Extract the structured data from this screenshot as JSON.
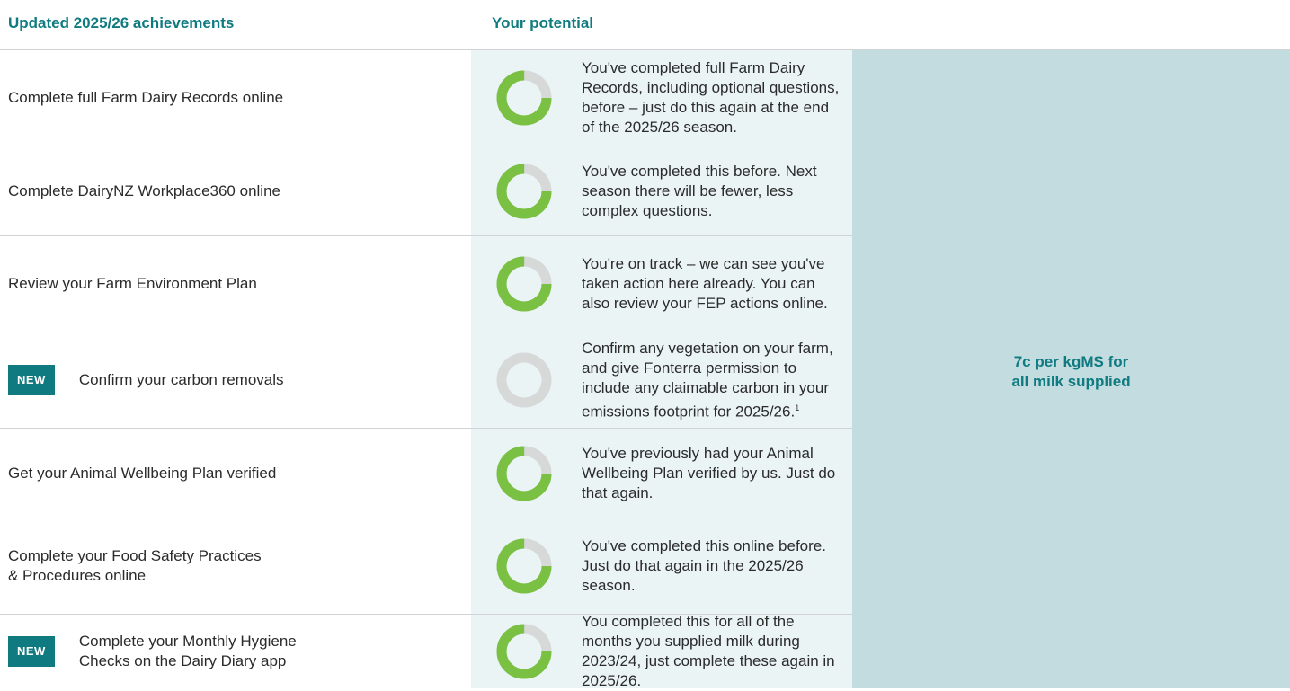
{
  "header": {
    "left": "Updated 2025/26 achievements",
    "right": "Your potential"
  },
  "reward": {
    "line1": "7c per kgMS for",
    "line2": "all milk supplied"
  },
  "colors": {
    "accent": "#0f7b80",
    "ring_done": "#7ac143",
    "ring_todo": "#d7d9d9"
  },
  "rows": [
    {
      "badge": "",
      "achievement": "Complete full Farm Dairy Records online",
      "potential": "You've completed full Farm Dairy Records, including optional questions, before – just do this again at the end of the 2025/26 season.",
      "footnote": "",
      "progress": 0.75
    },
    {
      "badge": "",
      "achievement": "Complete DairyNZ Workplace360 online",
      "potential": "You've completed this before. Next season there will be fewer, less complex questions.",
      "footnote": "",
      "progress": 0.75
    },
    {
      "badge": "",
      "achievement": "Review your Farm Environment Plan",
      "potential": "You're on track – we can see you've taken action here already. You can also review your FEP actions online.",
      "footnote": "",
      "progress": 0.75
    },
    {
      "badge": "NEW",
      "achievement": "Confirm your carbon removals",
      "potential": "Confirm any vegetation on your farm, and give Fonterra permission to include any claimable carbon in your emissions footprint for 2025/26.",
      "footnote": "1",
      "progress": 0
    },
    {
      "badge": "",
      "achievement": "Get your Animal Wellbeing Plan verified",
      "potential": "You've previously had your Animal Wellbeing Plan verified by us. Just do that again.",
      "footnote": "",
      "progress": 0.75
    },
    {
      "badge": "",
      "achievement": "Complete your Food Safety Practices\n& Procedures online",
      "potential": "You've completed this online before. Just do that again in the 2025/26 season.",
      "footnote": "",
      "progress": 0.75
    },
    {
      "badge": "NEW",
      "achievement": "Complete your Monthly Hygiene\nChecks on the Dairy Diary app",
      "potential": "You completed this for all of the months you supplied milk during 2023/24, just complete these again in 2025/26.",
      "footnote": "",
      "progress": 0.75
    }
  ]
}
